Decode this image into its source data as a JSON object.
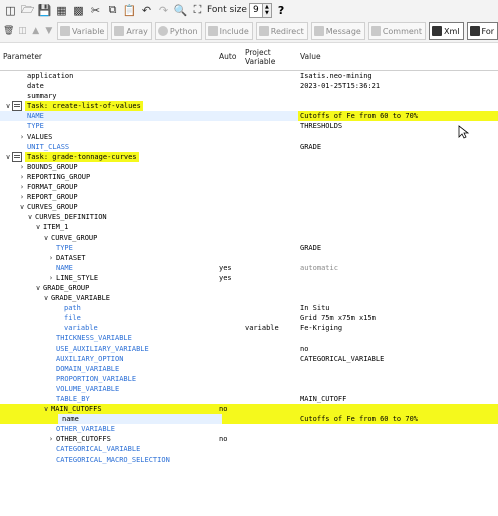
{
  "toolbar": {
    "font_size_label": "Font size",
    "font_size_value": "9",
    "help_label": "?"
  },
  "toolbar2": {
    "buttons": [
      {
        "label": "Variable"
      },
      {
        "label": "Array"
      },
      {
        "label": "Python"
      },
      {
        "label": "Include"
      },
      {
        "label": "Redirect"
      },
      {
        "label": "Message"
      },
      {
        "label": "Comment"
      },
      {
        "label": "Xml"
      },
      {
        "label": "For"
      }
    ]
  },
  "columns": {
    "parameter": "Parameter",
    "auto": "Auto",
    "project_variable_1": "Project",
    "project_variable_2": "Variable",
    "value": "Value"
  },
  "rows": [
    {
      "name": "application",
      "value": "Isatis.neo-mining"
    },
    {
      "name": "date",
      "value": "2023-01-25T15:36:21"
    },
    {
      "name": "summary",
      "value": ""
    },
    {
      "name": "Task: create-list-of-values",
      "value": ""
    },
    {
      "name": "NAME",
      "value": "Cutoffs of Fe from 60 to 70%"
    },
    {
      "name": "TYPE",
      "value": "THRESHOLDS"
    },
    {
      "name": "VALUES",
      "value": ""
    },
    {
      "name": "UNIT_CLASS",
      "value": "GRADE"
    },
    {
      "name": "Task: grade-tonnage-curves",
      "value": ""
    },
    {
      "name": "BOUNDS_GROUP",
      "value": ""
    },
    {
      "name": "REPORTING_GROUP",
      "value": ""
    },
    {
      "name": "FORMAT_GROUP",
      "value": ""
    },
    {
      "name": "REPORT_GROUP",
      "value": ""
    },
    {
      "name": "CURVES_GROUP",
      "value": ""
    },
    {
      "name": "CURVES_DEFINITION",
      "value": ""
    },
    {
      "name": "ITEM_1",
      "value": ""
    },
    {
      "name": "CURVE_GROUP",
      "value": ""
    },
    {
      "name": "TYPE",
      "value": "GRADE"
    },
    {
      "name": "DATASET",
      "value": ""
    },
    {
      "name": "NAME",
      "auto": "yes",
      "value": "automatic"
    },
    {
      "name": "LINE_STYLE",
      "auto": "yes",
      "value": ""
    },
    {
      "name": "GRADE_GROUP",
      "value": ""
    },
    {
      "name": "GRADE_VARIABLE",
      "value": ""
    },
    {
      "name": "path",
      "value": "In Situ"
    },
    {
      "name": "file",
      "value": "Grid 75m x75m x15m"
    },
    {
      "name": "variable",
      "project": "variable",
      "value": "Fe-Kriging"
    },
    {
      "name": "THICKNESS_VARIABLE",
      "value": ""
    },
    {
      "name": "USE_AUXILIARY_VARIABLE",
      "value": "no"
    },
    {
      "name": "AUXILIARY_OPTION",
      "value": "CATEGORICAL_VARIABLE"
    },
    {
      "name": "DOMAIN_VARIABLE",
      "value": ""
    },
    {
      "name": "PROPORTION_VARIABLE",
      "value": ""
    },
    {
      "name": "VOLUME_VARIABLE",
      "value": ""
    },
    {
      "name": "TABLE_BY",
      "value": "MAIN_CUTOFF"
    },
    {
      "name": "MAIN_CUTOFFS",
      "auto": "no",
      "value": ""
    },
    {
      "name": "name",
      "value": "Cutoffs of Fe from 60 to 70%"
    },
    {
      "name": "OTHER_VARIABLE",
      "value": ""
    },
    {
      "name": "OTHER_CUTOFFS",
      "auto": "no",
      "value": ""
    },
    {
      "name": "CATEGORICAL_VARIABLE",
      "value": ""
    },
    {
      "name": "CATEGORICAL_MACRO_SELECTION",
      "value": ""
    }
  ],
  "colors": {
    "highlight": "#f5f91c",
    "selected": "#e6f1ff",
    "blue_text": "#2b6fd6"
  }
}
